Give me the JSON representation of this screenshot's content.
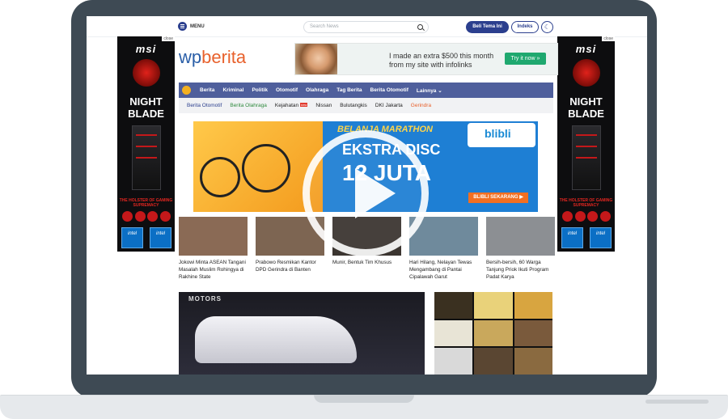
{
  "topbar": {
    "menu_label": "MENU",
    "search_placeholder": "Search News",
    "beli_button": "Beli Tema Ini",
    "indeks_button": "Indeks",
    "dark_mode_icon": "moon-icon"
  },
  "side_ad": {
    "close_label": "close",
    "brand": "msi",
    "title": "NIGHT BLADE",
    "tagline": "THE HOLSTER OF GAMING SUPREMACY",
    "intel_label": "intel"
  },
  "site": {
    "logo_main": "wp",
    "logo_accent": "berita"
  },
  "top_ad": {
    "text": "I made an extra $500 this month from my site with infolinks",
    "cta": "Try it now »"
  },
  "nav": {
    "items": [
      "Berita",
      "Kriminal",
      "Politik",
      "Otomotif",
      "Olahraga",
      "Tag Berita",
      "Berita Otomotif",
      "Lainnya ⌄"
    ]
  },
  "tags": {
    "items": [
      {
        "label": "Berita Otomotif",
        "color": "#2b3f8e"
      },
      {
        "label": "Berita Olahraga",
        "color": "#2f8a3e"
      },
      {
        "label": "Kejahatan",
        "color": "#222222",
        "badge": "new"
      },
      {
        "label": "Nissan",
        "color": "#222222"
      },
      {
        "label": "Bulutangkis",
        "color": "#222222"
      },
      {
        "label": "DKI Jakarta",
        "color": "#222222"
      },
      {
        "label": "Gerindra",
        "color": "#e8612c"
      }
    ]
  },
  "banner": {
    "headline": "BELANJA MARATHON",
    "discount": "EKSTRA DISC",
    "amount": "12 JUTA",
    "brand": "blibli",
    "cta": "BLIBLI SEKARANG ▶"
  },
  "news": [
    {
      "title": "Jokowi Minta ASEAN Tangani Masalah Muslim Rohingya di Rakhine State",
      "thumb_color": "#8a6a55"
    },
    {
      "title": "Prabowo Resmikan Kantor DPD Gerindra di Banten",
      "thumb_color": "#7d6552"
    },
    {
      "title": "Munir, Bentuk Tim Khusus",
      "thumb_color": "#3b3530"
    },
    {
      "title": "Hari Hilang, Nelayan Tewas Mengambang di Pantai Cipalawah Garut",
      "thumb_color": "#6f8a9c"
    },
    {
      "title": "Bersih-bersih, 60 Warga Tanjung Priok Ikuti Program Padat Karya",
      "thumb_color": "#8c8f93"
    }
  ],
  "feature": {
    "label": "MOTORS"
  },
  "colors": {
    "brand_blue": "#2b3f8e",
    "nav_bg": "#4f5f9c",
    "accent_orange": "#e8612c",
    "laptop_frame": "#3e4a54"
  }
}
